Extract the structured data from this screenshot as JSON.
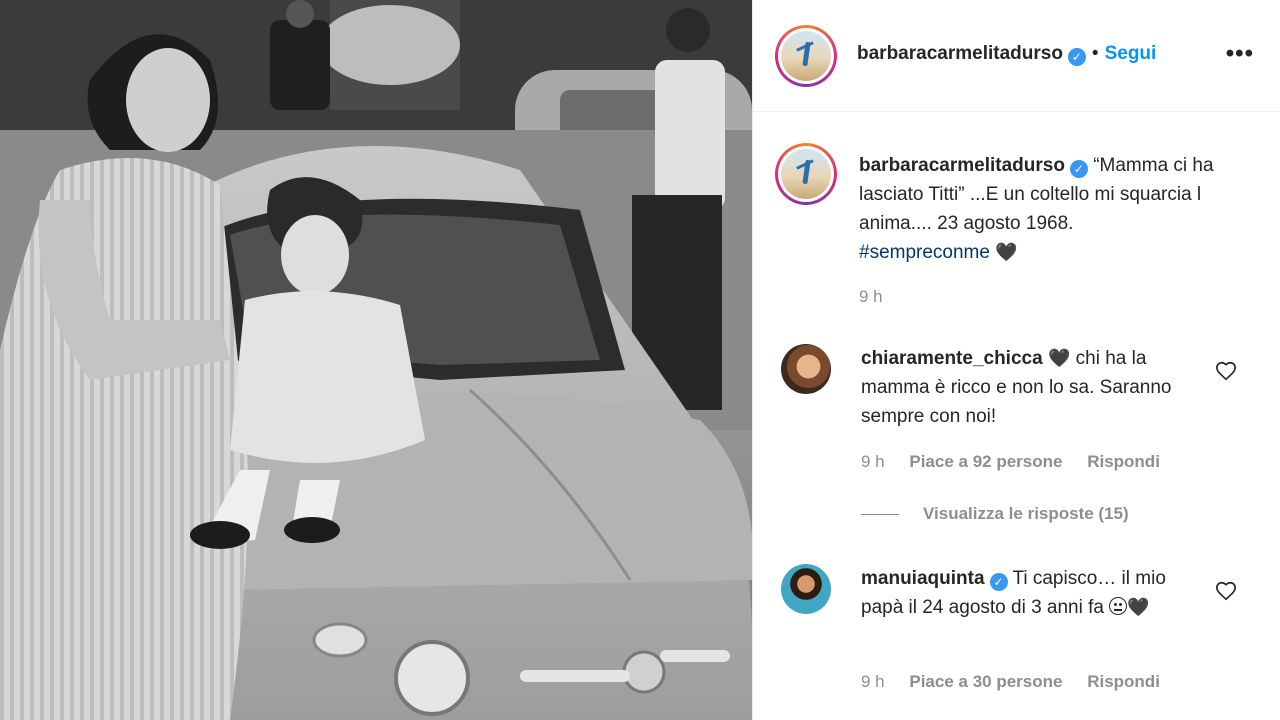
{
  "post": {
    "author": "barbaracarmelitadurso",
    "follow_label": "Segui",
    "separator": "•",
    "more_label": "•••"
  },
  "caption": {
    "username": "barbaracarmelitadurso",
    "text": "“Mamma ci ha lasciato Titti” ...E un coltello mi squarcia l anima.... 23 agosto 1968.",
    "hashtag": "#sempreconme",
    "emoji": "🖤",
    "time": "9 h"
  },
  "comments": [
    {
      "username": "chiaramente_chicca",
      "emoji": "🖤",
      "text": "chi ha la mamma è ricco e non lo sa. Saranno sempre con noi!",
      "time": "9 h",
      "likes": "Piace a 92 persone",
      "reply_label": "Rispondi",
      "view_replies": "Visualizza le risposte (15)"
    },
    {
      "username": "manuiaquinta",
      "text": "Ti capisco… il mio papà il 24 agosto di 3 anni fa",
      "emoji_trailing": "🖤",
      "time": "9 h",
      "likes": "Piace a 30 persone",
      "reply_label": "Rispondi"
    }
  ],
  "icons": {
    "verified": "verified-badge-icon",
    "like": "heart-outline-icon",
    "more": "more-options-icon"
  },
  "colors": {
    "link_blue": "#0095f6",
    "verified_blue": "#3897f0",
    "hashtag": "#00376b",
    "meta_gray": "#8e8e8e"
  }
}
